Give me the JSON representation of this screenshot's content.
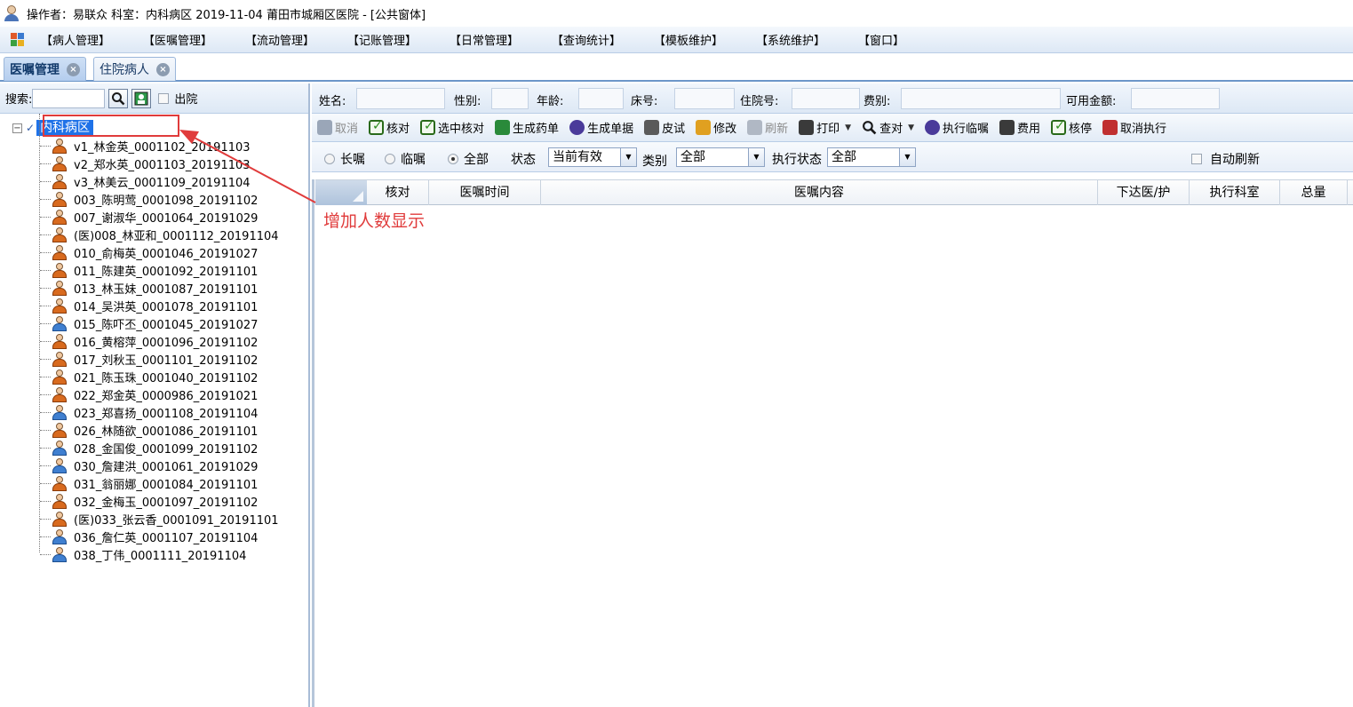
{
  "window": {
    "title": "操作者：易联众 科室：内科病区 2019-11-04 莆田市城厢区医院 - [公共窗体]"
  },
  "menu": {
    "items": [
      "【病人管理】",
      "【医嘱管理】",
      "【流动管理】",
      "【记账管理】",
      "【日常管理】",
      "【查询统计】",
      "【模板维护】",
      "【系统维护】",
      "【窗口】"
    ]
  },
  "tabs": [
    {
      "label": "医嘱管理",
      "active": true
    },
    {
      "label": "住院病人",
      "active": false
    }
  ],
  "search": {
    "label": "搜索:",
    "value": "",
    "discharged_label": "出院",
    "discharged_checked": false
  },
  "tree": {
    "root_label": "内科病区",
    "patients": [
      {
        "label": "v1_林金英_0001102_20191103",
        "gender": "female"
      },
      {
        "label": "v2_郑水英_0001103_20191103",
        "gender": "female"
      },
      {
        "label": "v3_林美云_0001109_20191104",
        "gender": "female"
      },
      {
        "label": "003_陈明莺_0001098_20191102",
        "gender": "female"
      },
      {
        "label": "007_谢淑华_0001064_20191029",
        "gender": "female"
      },
      {
        "label": "(医)008_林亚和_0001112_20191104",
        "gender": "female"
      },
      {
        "label": "010_俞梅英_0001046_20191027",
        "gender": "female"
      },
      {
        "label": "011_陈建英_0001092_20191101",
        "gender": "female"
      },
      {
        "label": "013_林玉妹_0001087_20191101",
        "gender": "female"
      },
      {
        "label": "014_吴洪英_0001078_20191101",
        "gender": "female"
      },
      {
        "label": "015_陈吓丕_0001045_20191027",
        "gender": "male"
      },
      {
        "label": "016_黄榕萍_0001096_20191102",
        "gender": "female"
      },
      {
        "label": "017_刘秋玉_0001101_20191102",
        "gender": "female"
      },
      {
        "label": "021_陈玉珠_0001040_20191102",
        "gender": "female"
      },
      {
        "label": "022_郑金英_0000986_20191021",
        "gender": "female"
      },
      {
        "label": "023_郑喜扬_0001108_20191104",
        "gender": "male"
      },
      {
        "label": "026_林随欲_0001086_20191101",
        "gender": "female"
      },
      {
        "label": "028_金国俊_0001099_20191102",
        "gender": "male"
      },
      {
        "label": "030_詹建洪_0001061_20191029",
        "gender": "male"
      },
      {
        "label": "031_翁丽娜_0001084_20191101",
        "gender": "female"
      },
      {
        "label": "032_金梅玉_0001097_20191102",
        "gender": "female"
      },
      {
        "label": "(医)033_张云香_0001091_20191101",
        "gender": "female"
      },
      {
        "label": "036_詹仁英_0001107_20191104",
        "gender": "male"
      },
      {
        "label": "038_丁伟_0001111_20191104",
        "gender": "male"
      }
    ]
  },
  "patient_info": {
    "name_label": "姓名:",
    "gender_label": "性别:",
    "age_label": "年龄:",
    "bed_label": "床号:",
    "admission_no_label": "住院号:",
    "fee_type_label": "费别:",
    "available_amount_label": "可用金额:"
  },
  "toolbar": {
    "buttons": [
      {
        "label": "取消",
        "icon": "undo-icon",
        "disabled": true,
        "color": "#9aa6b8"
      },
      {
        "label": "核对",
        "icon": "check-icon",
        "disabled": false,
        "color": "#3a8a2a"
      },
      {
        "label": "选中核对",
        "icon": "check-selected-icon",
        "disabled": false,
        "color": "#3a8a2a"
      },
      {
        "label": "生成药单",
        "icon": "medicine-icon",
        "disabled": false,
        "color": "#2a8a3a"
      },
      {
        "label": "生成单据",
        "icon": "gear-icon",
        "disabled": false,
        "color": "#4a3a9a"
      },
      {
        "label": "皮试",
        "icon": "pen-icon",
        "disabled": false,
        "color": "#5a5a5a"
      },
      {
        "label": "修改",
        "icon": "edit-icon",
        "disabled": false,
        "color": "#e0a020"
      },
      {
        "label": "刷新",
        "icon": "refresh-icon",
        "disabled": true,
        "color": "#b0b8c4"
      },
      {
        "label": "打印",
        "icon": "printer-icon",
        "disabled": false,
        "color": "#3a3a3a",
        "dropdown": true
      },
      {
        "label": "查对",
        "icon": "magnifier-icon",
        "disabled": false,
        "color": "#2a4a7a",
        "dropdown": true
      },
      {
        "label": "执行临嘱",
        "icon": "gear-icon",
        "disabled": false,
        "color": "#4a3a9a"
      },
      {
        "label": "费用",
        "icon": "calculator-icon",
        "disabled": false,
        "color": "#3a3a3a"
      },
      {
        "label": "核停",
        "icon": "check-icon",
        "disabled": false,
        "color": "#3a8a2a"
      },
      {
        "label": "取消执行",
        "icon": "cancel-exec-icon",
        "disabled": false,
        "color": "#c03030"
      }
    ]
  },
  "filters": {
    "long_term_label": "长嘱",
    "temporary_label": "临嘱",
    "all_label": "全部",
    "selected_order_type": "全部",
    "status_label": "状态",
    "status_value": "当前有效",
    "category_label": "类别",
    "category_value": "全部",
    "exec_status_label": "执行状态",
    "exec_status_value": "全部",
    "auto_refresh_label": "自动刷新",
    "auto_refresh_checked": false
  },
  "grid": {
    "columns": [
      "核对",
      "医嘱时间",
      "医嘱内容",
      "下达医/护",
      "执行科室",
      "总量"
    ],
    "rows": []
  },
  "annotation": {
    "text": "增加人数显示",
    "color": "#e03b3b"
  }
}
